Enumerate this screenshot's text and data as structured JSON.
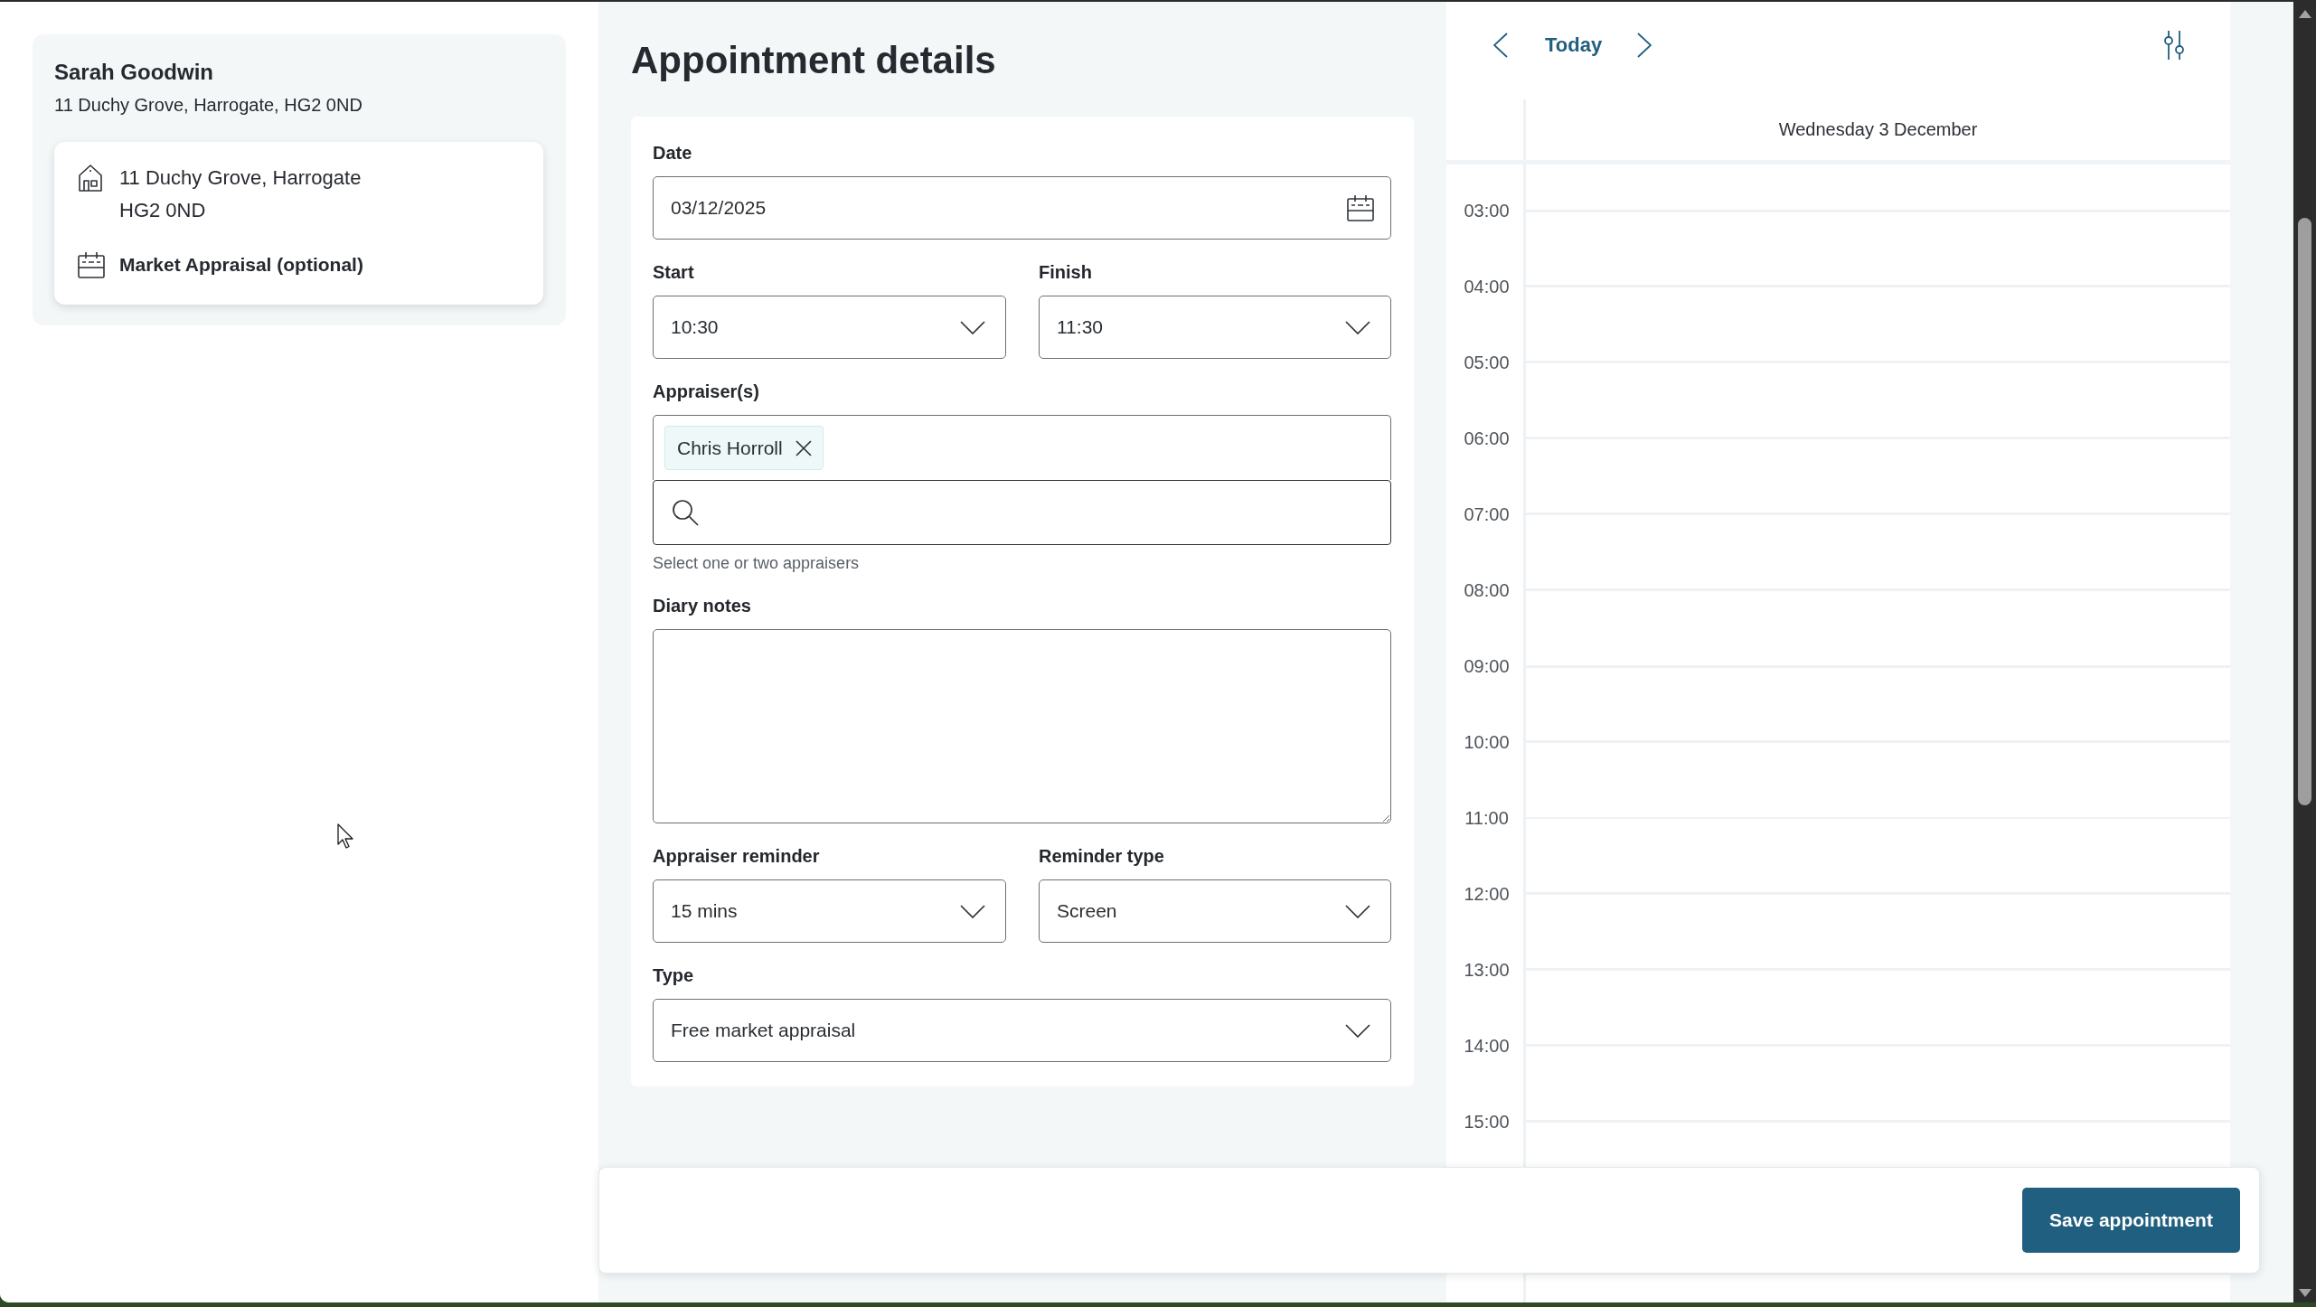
{
  "contact": {
    "name": "Sarah Goodwin",
    "address": "11 Duchy Grove, Harrogate, HG2 0ND"
  },
  "property": {
    "address_lines": [
      "11 Duchy Grove, Harrogate",
      "HG2 0ND"
    ],
    "appointment_type": "Market Appraisal (optional)"
  },
  "form": {
    "title": "Appointment details",
    "rows": [
      {
        "fields": [
          {
            "kind": "date",
            "label": "Date",
            "value": "03/12/2025"
          }
        ]
      },
      {
        "fields": [
          {
            "kind": "select",
            "label": "Start",
            "value": "10:30"
          },
          {
            "kind": "select",
            "label": "Finish",
            "value": "11:30"
          }
        ]
      },
      {
        "fields": [
          {
            "kind": "tags",
            "label": "Appraiser(s)",
            "tags": [
              "Chris Horroll"
            ],
            "hint": "Select one or two appraisers"
          }
        ]
      },
      {
        "fields": [
          {
            "kind": "textarea",
            "label": "Diary notes"
          }
        ]
      },
      {
        "fields": [
          {
            "kind": "select",
            "label": "Appraiser reminder",
            "value": "15 mins"
          },
          {
            "kind": "select",
            "label": "Reminder type",
            "value": "Screen"
          }
        ]
      },
      {
        "fields": [
          {
            "kind": "select",
            "label": "Type",
            "value": "Free market appraisal"
          }
        ]
      }
    ]
  },
  "calendar": {
    "today_button": "Today",
    "day_heading": "Wednesday 3 December",
    "hours": [
      "03:00",
      "04:00",
      "05:00",
      "06:00",
      "07:00",
      "08:00",
      "09:00",
      "10:00",
      "11:00",
      "12:00",
      "13:00",
      "14:00",
      "15:00"
    ]
  },
  "footer": {
    "save_button": "Save appointment"
  }
}
